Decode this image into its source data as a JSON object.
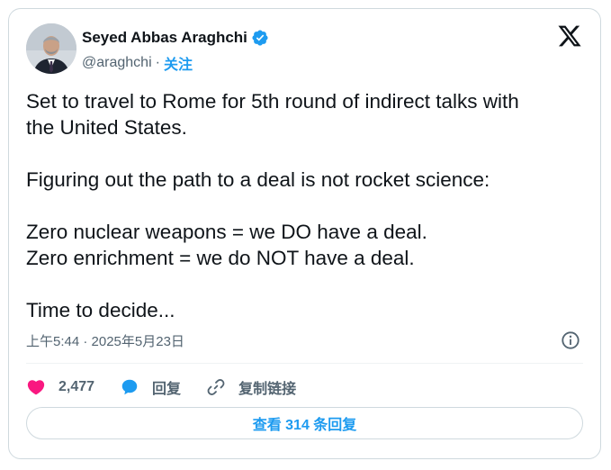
{
  "author": {
    "name": "Seyed Abbas Araghchi",
    "handle": "@araghchi",
    "separator": "·",
    "follow_label": "关注"
  },
  "icons": {
    "verified": "verified-badge-icon",
    "brand": "x-logo-icon",
    "info": "info-icon",
    "like": "heart-icon",
    "reply": "reply-bubble-icon",
    "copy_link": "link-icon"
  },
  "tweet": {
    "text": "Set to travel to Rome for 5th round of indirect talks with\nthe United States.\n\nFiguring out the path to a deal is not rocket science:\n\nZero nuclear weapons = we DO have a deal.\nZero enrichment = we do NOT have a deal.\n\nTime to decide...",
    "timestamp": "上午5:44 · 2025年5月23日"
  },
  "actions": {
    "like_count": "2,477",
    "reply_label": "回复",
    "copy_link_label": "复制链接"
  },
  "replies_button": "查看 314 条回复",
  "colors": {
    "accent": "#1d9bf0",
    "like": "#f91880",
    "text": "#0f1419",
    "muted": "#536471",
    "border": "#cfd9de"
  }
}
